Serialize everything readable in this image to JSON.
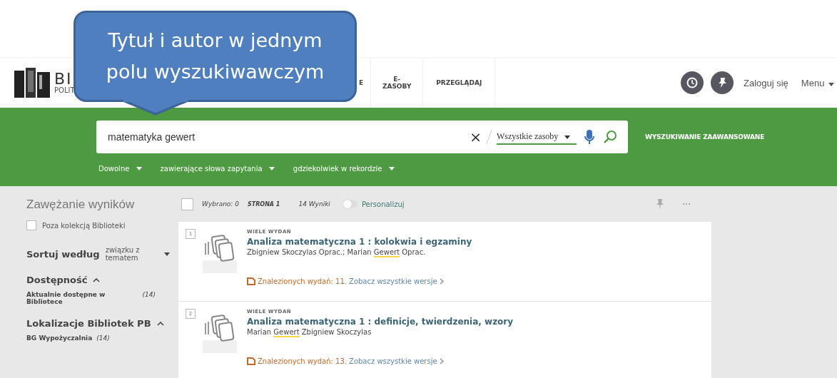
{
  "callout": {
    "text": "Tytuł i autor w jednym polu wyszukiwawczym"
  },
  "header": {
    "logo_title": "BI",
    "logo_subtitle": "POLIT",
    "nav": [
      {
        "label": "E"
      },
      {
        "label": "E-\nZASOBY"
      },
      {
        "label": "PRZEGLĄDAJ"
      }
    ],
    "login": "Zaloguj się",
    "menu": "Menu"
  },
  "search": {
    "value": "matematyka gewert",
    "clear": "×",
    "scope": "Wszystkie zasoby",
    "advanced": "WYSZUKIWANIE ZAAWANSOWANE",
    "filters": [
      {
        "label": "Dowolne"
      },
      {
        "label": "zawierające słowa zapytania"
      },
      {
        "label": "gdziekolwiek w rekordzie"
      }
    ]
  },
  "sidebar": {
    "title": "Zawężanie wyników",
    "outside_collection": {
      "label": "Poza kolekcją Biblioteki",
      "checked": false
    },
    "sort_label": "Sortuj według",
    "sort_value": "związku z tematem",
    "sections": [
      {
        "title": "Dostępność",
        "expanded": true,
        "items": [
          {
            "label": "Aktualnie dostępne w Bibliotece",
            "count": "(14)"
          }
        ]
      },
      {
        "title": "Lokalizacje Bibliotek PB",
        "expanded": true,
        "items": [
          {
            "label": "BG Wypożyczalnia",
            "count": "(14)"
          }
        ]
      }
    ]
  },
  "results_bar": {
    "select_all": false,
    "selected": "Wybrano: 0",
    "page": "STRONA 1",
    "count": "14 Wyniki",
    "personalize": {
      "label": "Personalizuj",
      "on": false
    }
  },
  "results": [
    {
      "number": "1",
      "type": "WIELE WYDAŃ",
      "title": "Analiza matematyczna 1 : kolokwia i egzaminy",
      "authors": [
        {
          "text": "Zbigniew Skoczylas Oprac.; Marian ",
          "hl": false
        },
        {
          "text": "Gewert",
          "hl": true
        },
        {
          "text": " Oprac.",
          "hl": false
        }
      ],
      "editions": "Znalezionych wydań: 11.",
      "see_all": "Zobacz wszystkie wersje"
    },
    {
      "number": "2",
      "type": "WIELE WYDAŃ",
      "title": "Analiza matematyczna 1 : definicje, twierdzenia, wzory",
      "authors": [
        {
          "text": "Marian ",
          "hl": false
        },
        {
          "text": "Gewert",
          "hl": true
        },
        {
          "text": " Zbigniew Skoczylas",
          "hl": false
        }
      ],
      "editions": "Znalezionych wydań: 13.",
      "see_all": "Zobacz wszystkie wersje"
    }
  ]
}
